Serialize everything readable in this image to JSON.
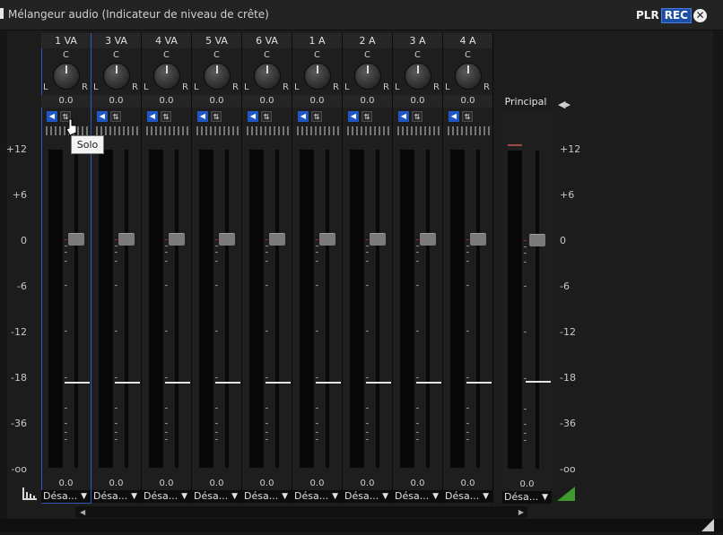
{
  "window": {
    "title": "Mélangeur audio (Indicateur de niveau de crête)",
    "logo_left": "PLR",
    "logo_right": "REC",
    "close_icon": "close-icon"
  },
  "scale": {
    "labels": [
      "+12",
      "+6",
      "0",
      "-6",
      "-12",
      "-18",
      "-36",
      "-oo"
    ]
  },
  "channels": [
    {
      "name": "1 VA",
      "pan_center": "C",
      "pan_left": "L",
      "pan_right": "R",
      "pan_value": "0.0",
      "volume": "0.0",
      "routing": "Désa...",
      "selected": true
    },
    {
      "name": "3 VA",
      "pan_center": "C",
      "pan_left": "L",
      "pan_right": "R",
      "pan_value": "0.0",
      "volume": "0.0",
      "routing": "Désa...",
      "selected": false
    },
    {
      "name": "4 VA",
      "pan_center": "C",
      "pan_left": "L",
      "pan_right": "R",
      "pan_value": "0.0",
      "volume": "0.0",
      "routing": "Désa...",
      "selected": false
    },
    {
      "name": "5 VA",
      "pan_center": "C",
      "pan_left": "L",
      "pan_right": "R",
      "pan_value": "0.0",
      "volume": "0.0",
      "routing": "Désa...",
      "selected": false
    },
    {
      "name": "6 VA",
      "pan_center": "C",
      "pan_left": "L",
      "pan_right": "R",
      "pan_value": "0.0",
      "volume": "0.0",
      "routing": "Désa...",
      "selected": false
    },
    {
      "name": "1 A",
      "pan_center": "C",
      "pan_left": "L",
      "pan_right": "R",
      "pan_value": "0.0",
      "volume": "0.0",
      "routing": "Désa...",
      "selected": false
    },
    {
      "name": "2 A",
      "pan_center": "C",
      "pan_left": "L",
      "pan_right": "R",
      "pan_value": "0.0",
      "volume": "0.0",
      "routing": "Désa...",
      "selected": false
    },
    {
      "name": "3 A",
      "pan_center": "C",
      "pan_left": "L",
      "pan_right": "R",
      "pan_value": "0.0",
      "volume": "0.0",
      "routing": "Désa...",
      "selected": false
    },
    {
      "name": "4 A",
      "pan_center": "C",
      "pan_left": "L",
      "pan_right": "R",
      "pan_value": "0.0",
      "volume": "0.0",
      "routing": "Désa...",
      "selected": false
    }
  ],
  "master": {
    "name": "Principal",
    "volume": "0.0",
    "routing": "Désa..."
  },
  "tooltip": {
    "text": "Solo"
  },
  "colors": {
    "accent": "#1f56c2",
    "play_green": "#3e9a2c"
  },
  "icons": {
    "mute": "speaker-icon",
    "solo": "solo-icon",
    "mixer": "mixer-settings-icon",
    "play": "play-icon",
    "output": "speaker-output-icon"
  }
}
